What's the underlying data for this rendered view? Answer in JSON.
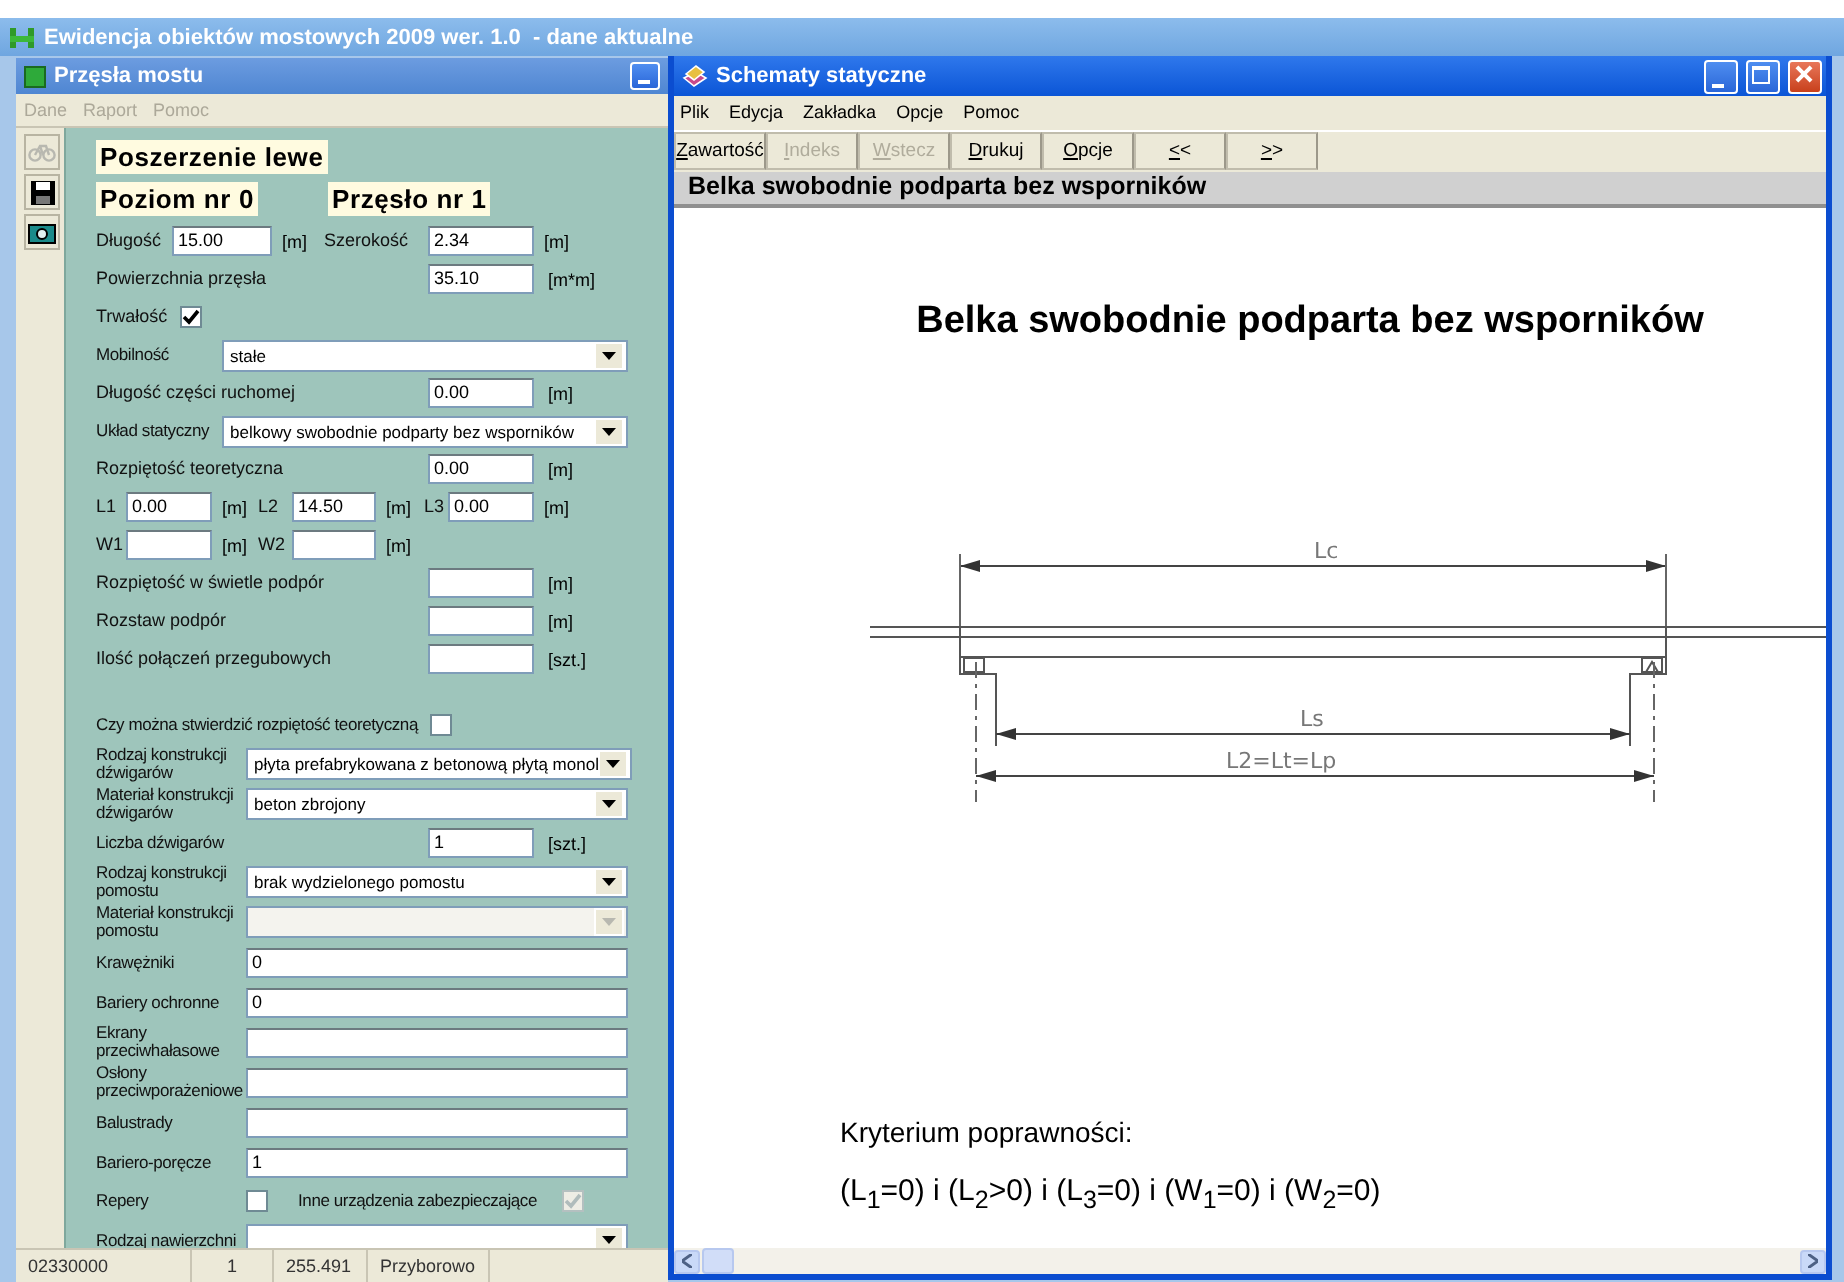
{
  "app": {
    "title": "Ewidencja obiektów mostowych 2009 wer. 1.0  - dane aktualne"
  },
  "left_window": {
    "title": "Przęsła mostu",
    "menu": [
      {
        "label": "Dane",
        "disabled": true
      },
      {
        "label": "Raport",
        "disabled": true
      },
      {
        "label": "Pomoc",
        "disabled": true
      }
    ],
    "toolbar": [
      {
        "kind": "bicycle",
        "disabled": true
      },
      {
        "kind": "save",
        "disabled": false
      },
      {
        "kind": "camera",
        "disabled": false
      }
    ],
    "heading_rows": [
      [
        "Poszerzenie lewe"
      ],
      [
        "Poziom nr 0",
        "Przęsło nr 1"
      ]
    ],
    "rows": [
      {
        "kind": "pair",
        "groups": [
          {
            "label": "Długość",
            "value": "15.00",
            "unit": "[m]"
          },
          {
            "label": "Szerokość",
            "value": "2.34",
            "unit": "[m]"
          }
        ]
      },
      {
        "kind": "field",
        "label": "Powierzchnia przęsła",
        "value": "35.10",
        "unit": "[m*m]"
      },
      {
        "kind": "check",
        "label": "Trwałość",
        "checked": true,
        "disabled": false
      },
      {
        "kind": "select",
        "label": "Mobilność",
        "value": "stałe",
        "disabled": false
      },
      {
        "kind": "field",
        "label": "Długość części ruchomej",
        "value": "0.00",
        "unit": "[m]"
      },
      {
        "kind": "select",
        "label": "Układ statyczny",
        "value": "belkowy swobodnie podparty bez wsporników",
        "disabled": false
      },
      {
        "kind": "field",
        "label": "Rozpiętość teoretyczna",
        "value": "0.00",
        "unit": "[m]"
      },
      {
        "kind": "triple",
        "groups": [
          {
            "label": "L1",
            "value": "0.00",
            "unit": "[m]"
          },
          {
            "label": "L2",
            "value": "14.50",
            "unit": "[m]"
          },
          {
            "label": "L3",
            "value": "0.00",
            "unit": "[m]"
          }
        ]
      },
      {
        "kind": "triple",
        "groups": [
          {
            "label": "W1",
            "unit": "[m]"
          },
          {
            "label": "W2",
            "unit": "[m]"
          }
        ]
      },
      {
        "kind": "field",
        "label": "Rozpiętość w świetle podpór",
        "unit": "[m]"
      },
      {
        "kind": "field",
        "label": "Rozstaw podpór",
        "unit": "[m]"
      },
      {
        "kind": "field",
        "label": "Ilość połączeń przegubowych",
        "unit": "[szt.]"
      }
    ],
    "detail_rows": [
      {
        "kind": "check",
        "label": "Czy można stwierdzić rozpiętość teoretyczną",
        "checked": false,
        "disabled": false
      },
      {
        "kind": "select",
        "label": "Rodzaj konstrukcji dźwigarów",
        "value": "płyta prefabrykowana z betonową płytą monol",
        "disabled": false
      },
      {
        "kind": "select",
        "label": "Materiał konstrukcji dźwigarów",
        "value": "beton zbrojony",
        "disabled": false
      },
      {
        "kind": "field",
        "label": "Liczba dźwigarów",
        "value": "1",
        "unit": "[szt.]"
      },
      {
        "kind": "select",
        "label": "Rodzaj konstrukcji pomostu",
        "value": "brak wydzielonego pomostu",
        "disabled": false
      },
      {
        "kind": "select",
        "label": "Materiał konstrukcji pomostu",
        "disabled": true
      },
      {
        "kind": "text",
        "label": "Krawężniki",
        "value": "0"
      },
      {
        "kind": "text",
        "label": "Bariery ochronne",
        "value": "0"
      },
      {
        "kind": "text",
        "label": "Ekrany przeciwhałasowe"
      },
      {
        "kind": "text",
        "label": "Osłony przeciwporażeniowe"
      },
      {
        "kind": "text",
        "label": "Balustrady"
      },
      {
        "kind": "text",
        "label": "Bariero-poręcze",
        "value": "1"
      },
      {
        "kind": "checks",
        "groups": [
          {
            "label": "Repery",
            "checked": false,
            "disabled": false
          },
          {
            "label": "Inne urządzenia zabezpieczające",
            "checked": true,
            "disabled": true
          }
        ]
      },
      {
        "kind": "select",
        "label": "Rodzaj nawierzchni",
        "disabled": false
      }
    ],
    "status_bar": [
      "02330000",
      "1",
      "255.491",
      "Przyborowo"
    ]
  },
  "right_window": {
    "title": "Schematy statyczne",
    "menu": [
      "Plik",
      "Edycja",
      "Zakładka",
      "Opcje",
      "Pomoc"
    ],
    "toolbar": [
      {
        "label": "Zawartość",
        "disabled": false
      },
      {
        "label": "Indeks",
        "disabled": true
      },
      {
        "label": "Wstecz",
        "disabled": true
      },
      {
        "label": "Drukuj",
        "disabled": false
      },
      {
        "label": "Opcje",
        "disabled": false
      },
      {
        "label": "<<",
        "disabled": false
      },
      {
        "label": ">>",
        "disabled": false
      }
    ],
    "topic": "Belka swobodnie podparta bez wsporników",
    "page": {
      "title": "Belka swobodnie podparta bez wsporników",
      "diagram_labels": [
        "Lc",
        "Ls",
        "L2=Lt=Lp"
      ],
      "criterion_title": "Kryterium poprawności:",
      "criterion": "(L$_{1}$=0) i (L$_{2}$>0) i (L$_{3}$=0) i (W$_{1}$=0) i (W$_{2}$=0)"
    }
  }
}
